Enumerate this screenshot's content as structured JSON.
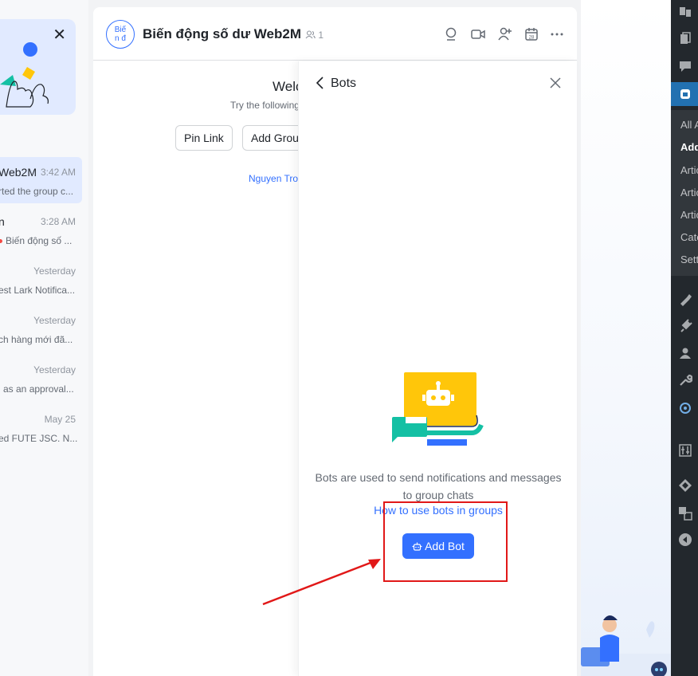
{
  "chat_list": {
    "items": [
      {
        "name": "Web2M",
        "time": "3:42 AM",
        "preview": "rted the group c...",
        "active": true
      },
      {
        "name": "n",
        "time": "3:28 AM",
        "preview": "Biến động số ...",
        "unread": true
      },
      {
        "name": "",
        "time": "Yesterday",
        "preview": "est Lark Notifica..."
      },
      {
        "name": "",
        "time": "Yesterday",
        "preview": "ch hàng mới đã..."
      },
      {
        "name": "",
        "time": "Yesterday",
        "preview": "l as an approval..."
      },
      {
        "name": "",
        "time": "May 25",
        "preview": "ed FUTE JSC. N..."
      }
    ]
  },
  "chat": {
    "avatar_text_line1": "Biế",
    "avatar_text_line2": "n đ",
    "title": "Biến động số dư Web2M",
    "member_count": "1",
    "welcome_title": "Welco",
    "welcome_sub": "Try the following",
    "pin_link_label": "Pin Link",
    "add_group_label": "Add Group",
    "welcome_link": "Nguyen Tro"
  },
  "bots_panel": {
    "title": "Bots",
    "description": "Bots are used to send notifications and messages to group chats",
    "help_link": "How to use bots in groups",
    "add_bot_label": "Add Bot"
  },
  "wp_sidebar": {
    "submenu": [
      "All A",
      "Add",
      "Artic",
      "Artic",
      "Artic",
      "Cate",
      "Setti"
    ],
    "current_index": 1
  },
  "colors": {
    "accent": "#3370ff",
    "annotation": "#e11818",
    "wp_bg": "#23282d",
    "wp_active": "#2271b1"
  }
}
